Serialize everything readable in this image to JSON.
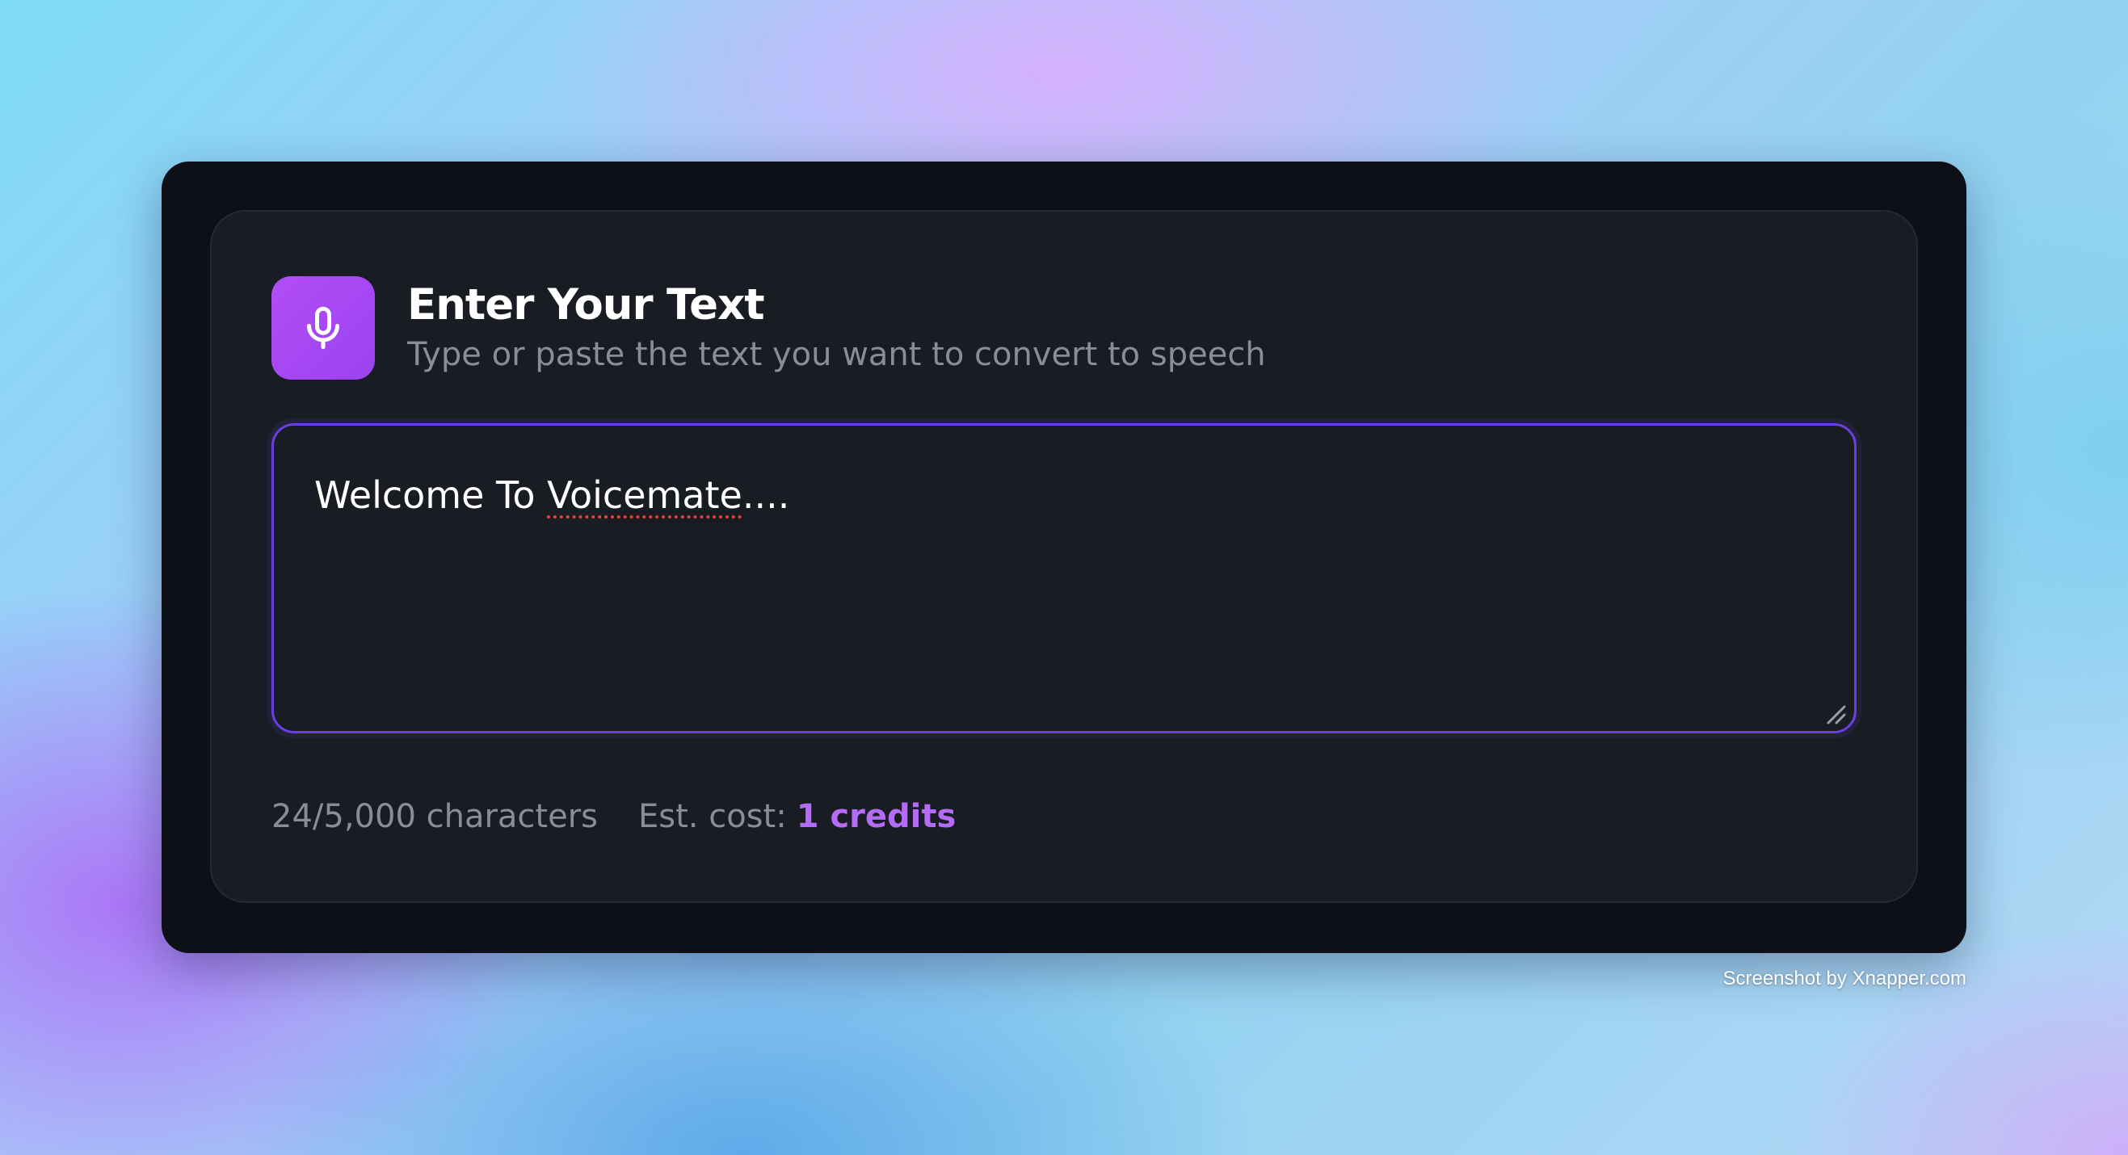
{
  "card": {
    "title": "Enter Your Text",
    "subtitle": "Type or paste the text you want to convert to speech",
    "icon": "microphone-icon"
  },
  "textarea": {
    "value_prefix": "Welcome To ",
    "value_misspelled": "Voicemate",
    "value_suffix": "...."
  },
  "footer": {
    "char_count": "24/5,000 characters",
    "cost_label": "Est. cost:",
    "cost_value": "1 credits"
  },
  "watermark": "Screenshot by Xnapper.com",
  "colors": {
    "accent": "#a24ff2",
    "focus_border": "#6a3fe0",
    "credits_text": "#b46cf7",
    "card_bg": "#1a1c24",
    "window_bg": "#0e1017"
  }
}
